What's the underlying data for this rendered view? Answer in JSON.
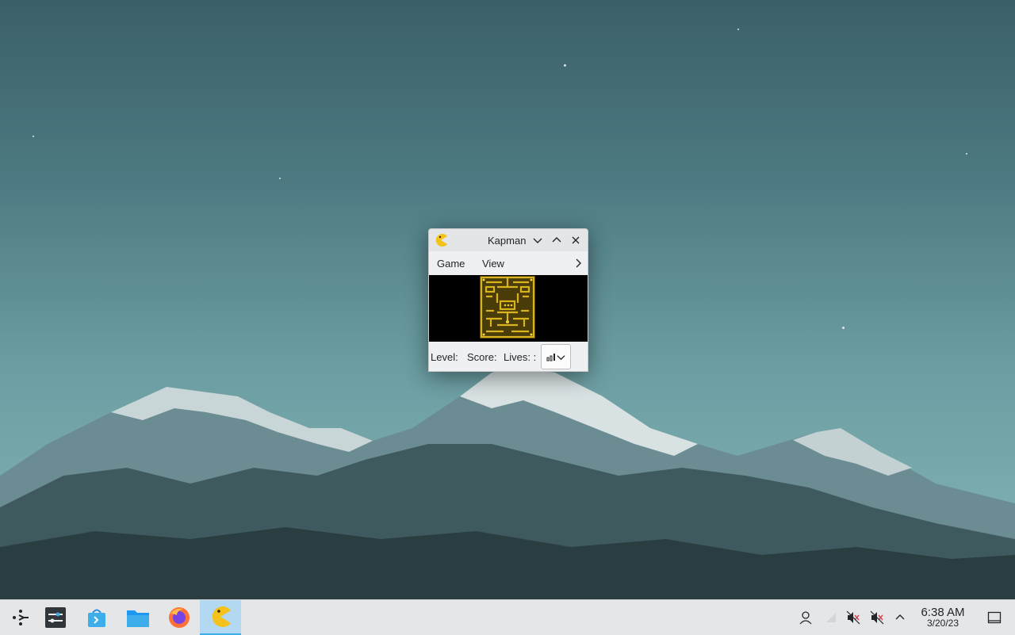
{
  "desktop": {
    "wallpaper": "mountain-landscape"
  },
  "window": {
    "title": "Kapman",
    "menus": [
      "Game",
      "View"
    ],
    "status": {
      "level_label": "Level:",
      "score_label": "Score:",
      "lives_label": "Lives: :"
    }
  },
  "taskbar": {
    "launchers": [
      "application-launcher",
      "system-settings",
      "discover",
      "file-manager",
      "firefox",
      "kapman"
    ],
    "active": "kapman"
  },
  "clock": {
    "time": "6:38 AM",
    "date": "3/20/23"
  },
  "colors": {
    "accent": "#3daee9",
    "maze": "#c8a21a",
    "taskbar": "#e4e6e8"
  }
}
